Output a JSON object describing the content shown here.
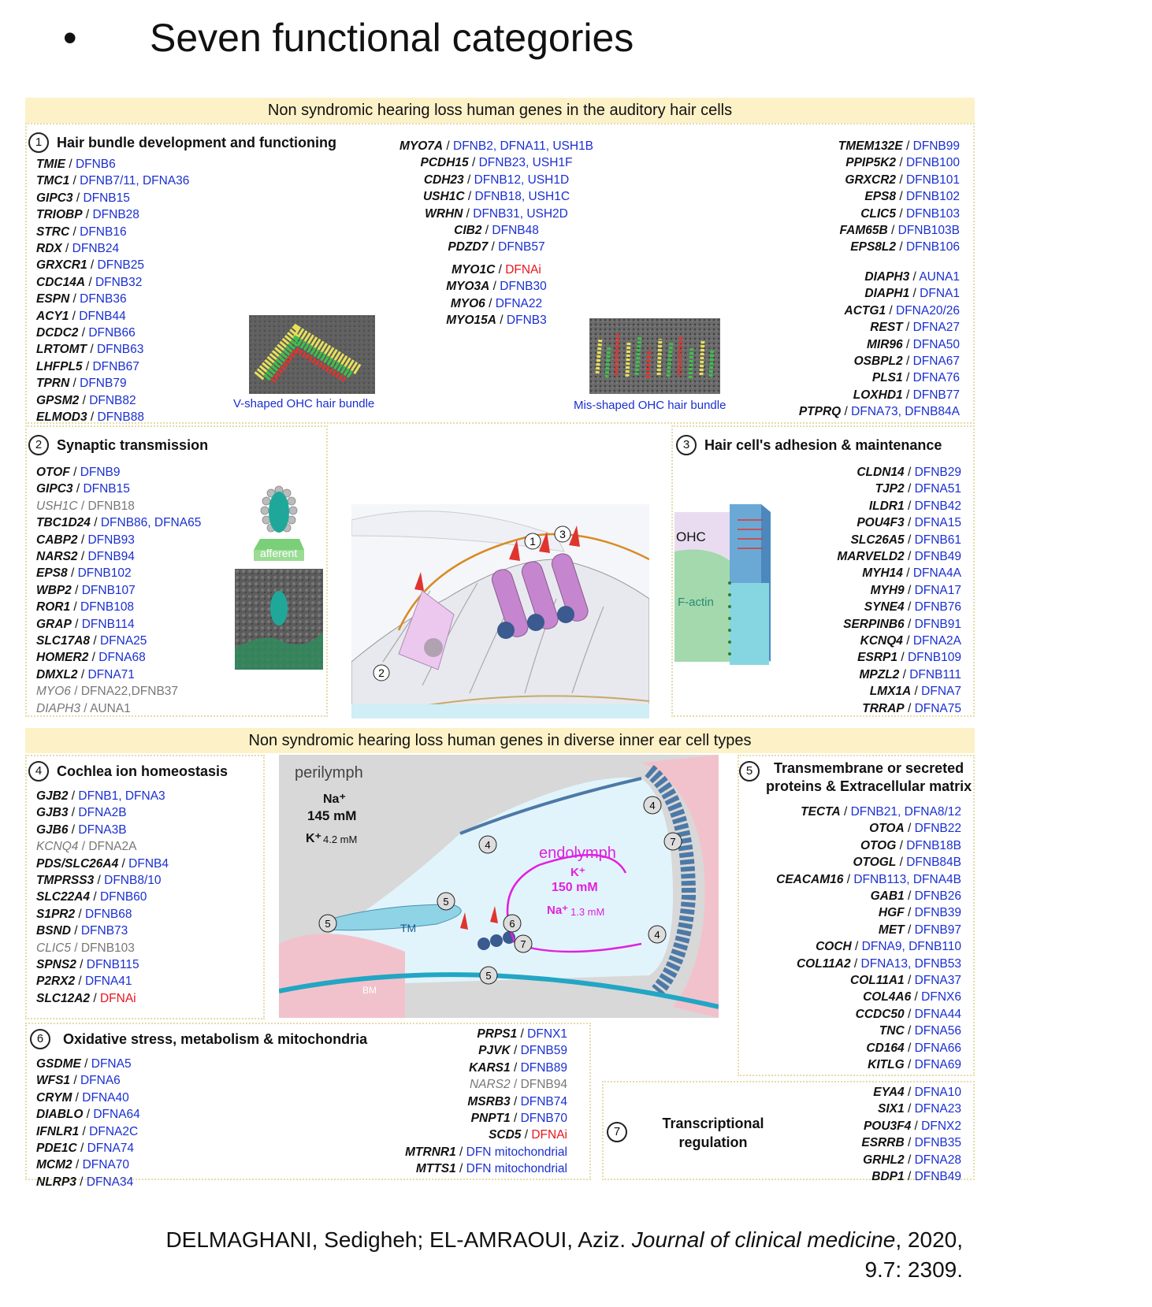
{
  "slide": {
    "bullet": "•",
    "title": "Seven functional categories"
  },
  "banner_top": "Non syndromic hearing loss human genes in the auditory hair cells",
  "banner_mid": "Non syndromic hearing loss human genes in diverse inner ear cell types",
  "sections": {
    "s1": {
      "num": "1",
      "title": "Hair bundle development and functioning",
      "col1": [
        {
          "g": "TMIE",
          "d": "DFNB6"
        },
        {
          "g": "TMC1",
          "d": "DFNB7/11, DFNA36"
        },
        {
          "g": "GIPC3",
          "d": "DFNB15"
        },
        {
          "g": "TRIOBP",
          "d": "DFNB28"
        },
        {
          "g": "STRC",
          "d": "DFNB16"
        },
        {
          "g": "RDX",
          "d": "DFNB24"
        },
        {
          "g": "GRXCR1",
          "d": "DFNB25"
        },
        {
          "g": "CDC14A",
          "d": "DFNB32"
        },
        {
          "g": "ESPN",
          "d": "DFNB36"
        },
        {
          "g": "ACY1",
          "d": "DFNB44"
        },
        {
          "g": "DCDC2",
          "d": "DFNB66"
        },
        {
          "g": "LRTOMT",
          "d": "DFNB63"
        },
        {
          "g": "LHFPL5",
          "d": "DFNB67"
        },
        {
          "g": "TPRN",
          "d": "DFNB79"
        },
        {
          "g": "GPSM2",
          "d": "DFNB82"
        },
        {
          "g": "ELMOD3",
          "d": "DFNB88"
        }
      ],
      "col2a": [
        {
          "g": "MYO7A",
          "d": "DFNB2, DFNA11, USH1B"
        },
        {
          "g": "PCDH15",
          "d": "DFNB23, USH1F"
        },
        {
          "g": "CDH23",
          "d": "DFNB12, USH1D"
        },
        {
          "g": "USH1C",
          "d": "DFNB18, USH1C"
        },
        {
          "g": "WRHN",
          "d": "DFNB31, USH2D"
        },
        {
          "g": "CIB2",
          "d": "DFNB48"
        },
        {
          "g": "PDZD7",
          "d": "DFNB57"
        }
      ],
      "col2b": [
        {
          "g": "MYO1C",
          "d": "DFNAi",
          "red": true
        },
        {
          "g": "MYO3A",
          "d": "DFNB30"
        },
        {
          "g": "MYO6",
          "d": "DFNA22"
        },
        {
          "g": "MYO15A",
          "d": "DFNB3"
        }
      ],
      "col3a": [
        {
          "g": "TMEM132E",
          "d": "DFNB99"
        },
        {
          "g": "PPIP5K2",
          "d": "DFNB100"
        },
        {
          "g": "GRXCR2",
          "d": "DFNB101"
        },
        {
          "g": "EPS8",
          "d": "DFNB102"
        },
        {
          "g": "CLIC5",
          "d": "DFNB103"
        },
        {
          "g": "FAM65B",
          "d": "DFNB103B"
        },
        {
          "g": "EPS8L2",
          "d": "DFNB106"
        }
      ],
      "col3b": [
        {
          "g": "DIAPH3",
          "d": "AUNA1"
        },
        {
          "g": "DIAPH1",
          "d": "DFNA1"
        },
        {
          "g": "ACTG1",
          "d": "DFNA20/26"
        },
        {
          "g": "REST",
          "d": "DFNA27"
        },
        {
          "g": "MIR96",
          "d": "DFNA50"
        },
        {
          "g": "OSBPL2",
          "d": "DFNA67"
        },
        {
          "g": "PLS1",
          "d": "DFNA76"
        },
        {
          "g": "LOXHD1",
          "d": "DFNB77"
        },
        {
          "g": "PTPRQ",
          "d": "DFNA73, DFNB84A"
        }
      ],
      "caption_left": "V-shaped OHC hair bundle",
      "caption_right": "Mis-shaped OHC hair bundle"
    },
    "s2": {
      "num": "2",
      "title": "Synaptic transmission",
      "genes": [
        {
          "g": "OTOF",
          "d": "DFNB9"
        },
        {
          "g": "GIPC3",
          "d": "DFNB15"
        },
        {
          "g": "USH1C",
          "d": "DFNB18",
          "gray": true
        },
        {
          "g": "TBC1D24",
          "d": "DFNB86, DFNA65"
        },
        {
          "g": "CABP2",
          "d": "DFNB93"
        },
        {
          "g": "NARS2",
          "d": "DFNB94"
        },
        {
          "g": "EPS8",
          "d": "DFNB102"
        },
        {
          "g": "WBP2",
          "d": "DFNB107"
        },
        {
          "g": "ROR1",
          "d": "DFNB108"
        },
        {
          "g": "GRAP",
          "d": "DFNB114"
        },
        {
          "g": "SLC17A8",
          "d": "DFNA25"
        },
        {
          "g": "HOMER2",
          "d": "DFNA68"
        },
        {
          "g": "DMXL2",
          "d": "DFNA71"
        },
        {
          "g": "MYO6",
          "d": "DFNA22,DFNB37",
          "gray": true
        },
        {
          "g": "DIAPH3",
          "d": "AUNA1",
          "gray": true
        }
      ],
      "afferent_label": "afferent"
    },
    "s3": {
      "num": "3",
      "title": "Hair cell's adhesion & maintenance",
      "genes": [
        {
          "g": "CLDN14",
          "d": "DFNB29"
        },
        {
          "g": "TJP2",
          "d": "DFNA51"
        },
        {
          "g": "ILDR1",
          "d": "DFNB42"
        },
        {
          "g": "POU4F3",
          "d": "DFNA15"
        },
        {
          "g": "SLC26A5",
          "d": "DFNB61"
        },
        {
          "g": "MARVELD2",
          "d": "DFNB49"
        },
        {
          "g": "MYH14",
          "d": "DFNA4A"
        },
        {
          "g": "MYH9",
          "d": "DFNA17"
        },
        {
          "g": "SYNE4",
          "d": "DFNB76"
        },
        {
          "g": "SERPINB6",
          "d": "DFNB91"
        },
        {
          "g": "KCNQ4",
          "d": "DFNA2A"
        },
        {
          "g": "ESRP1",
          "d": "DFNB109"
        },
        {
          "g": "MPZL2",
          "d": "DFNB111"
        },
        {
          "g": "LMX1A",
          "d": "DFNA7"
        },
        {
          "g": "TRRAP",
          "d": "DFNA75"
        }
      ],
      "ohc_label": "OHC",
      "factin_label": "F-actin"
    },
    "s4": {
      "num": "4",
      "title": "Cochlea ion homeostasis",
      "genes": [
        {
          "g": "GJB2",
          "d": "DFNB1, DFNA3"
        },
        {
          "g": "GJB3",
          "d": "DFNA2B"
        },
        {
          "g": "GJB6",
          "d": "DFNA3B"
        },
        {
          "g": "KCNQ4",
          "d": "DFNA2A",
          "gray": true
        },
        {
          "g": "PDS/SLC26A4",
          "d": "DFNB4"
        },
        {
          "g": "TMPRSS3",
          "d": "DFNB8/10"
        },
        {
          "g": "SLC22A4",
          "d": "DFNB60"
        },
        {
          "g": "S1PR2",
          "d": "DFNB68"
        },
        {
          "g": "BSND",
          "d": "DFNB73"
        },
        {
          "g": "CLIC5",
          "d": "DFNB103",
          "gray": true
        },
        {
          "g": "SPNS2",
          "d": "DFNB115"
        },
        {
          "g": "P2RX2",
          "d": "DFNA41"
        },
        {
          "g": "SLC12A2",
          "d": "DFNAi",
          "red": true
        }
      ]
    },
    "s5": {
      "num": "5",
      "title_line1": "Transmembrane or secreted",
      "title_line2": "proteins & Extracellular matrix",
      "genes": [
        {
          "g": "TECTA",
          "d": "DFNB21, DFNA8/12"
        },
        {
          "g": "OTOA",
          "d": "DFNB22"
        },
        {
          "g": "OTOG",
          "d": "DFNB18B"
        },
        {
          "g": "OTOGL",
          "d": "DFNB84B"
        },
        {
          "g": "CEACAM16",
          "d": "DFNB113, DFNA4B"
        },
        {
          "g": "GAB1",
          "d": "DFNB26"
        },
        {
          "g": "HGF",
          "d": "DFNB39"
        },
        {
          "g": "MET",
          "d": "DFNB97"
        },
        {
          "g": "COCH",
          "d": "DFNA9, DFNB110"
        },
        {
          "g": "COL11A2",
          "d": "DFNA13, DFNB53"
        },
        {
          "g": "COL11A1",
          "d": "DFNA37"
        },
        {
          "g": "COL4A6",
          "d": "DFNX6"
        },
        {
          "g": "CCDC50",
          "d": "DFNA44"
        },
        {
          "g": "TNC",
          "d": "DFNA56"
        },
        {
          "g": "CD164",
          "d": "DFNA66"
        },
        {
          "g": "KITLG",
          "d": "DFNA69"
        }
      ]
    },
    "s6": {
      "num": "6",
      "title": "Oxidative stress, metabolism & mitochondria",
      "col1": [
        {
          "g": "GSDME",
          "d": "DFNA5"
        },
        {
          "g": "WFS1",
          "d": "DFNA6"
        },
        {
          "g": "CRYM",
          "d": "DFNA40"
        },
        {
          "g": "DIABLO",
          "d": "DFNA64"
        },
        {
          "g": "IFNLR1",
          "d": "DFNA2C"
        },
        {
          "g": "PDE1C",
          "d": "DFNA74"
        },
        {
          "g": "MCM2",
          "d": "DFNA70"
        },
        {
          "g": "NLRP3",
          "d": "DFNA34"
        }
      ],
      "col2": [
        {
          "g": "PRPS1",
          "d": "DFNX1"
        },
        {
          "g": "PJVK",
          "d": "DFNB59"
        },
        {
          "g": "KARS1",
          "d": "DFNB89"
        },
        {
          "g": "NARS2",
          "d": "DFNB94",
          "gray": true
        },
        {
          "g": "MSRB3",
          "d": "DFNB74"
        },
        {
          "g": "PNPT1",
          "d": "DFNB70"
        },
        {
          "g": "SCD5",
          "d": "DFNAi",
          "red": true
        },
        {
          "g": "MTRNR1",
          "d": "DFN mitochondrial"
        },
        {
          "g": "MTTS1",
          "d": "DFN mitochondrial"
        }
      ]
    },
    "s7": {
      "num": "7",
      "title_line1": "Transcriptional",
      "title_line2": "regulation",
      "genes": [
        {
          "g": "EYA4",
          "d": "DFNA10"
        },
        {
          "g": "SIX1",
          "d": "DFNA23"
        },
        {
          "g": "POU3F4",
          "d": "DFNX2"
        },
        {
          "g": "ESRRB",
          "d": "DFNB35"
        },
        {
          "g": "GRHL2",
          "d": "DFNA28"
        },
        {
          "g": "BDP1",
          "d": "DFNB49"
        }
      ]
    }
  },
  "cochlea": {
    "perilymph": "perilymph",
    "peri_na": "Na⁺",
    "peri_na_conc": "145 mM",
    "peri_k": "K⁺",
    "peri_k_conc": "4.2 mM",
    "endolymph": "endolymph",
    "endo_k": "K⁺",
    "endo_k_conc": "150 mM",
    "endo_na": "Na⁺",
    "endo_na_conc": "1.3 mM",
    "tm": "TM",
    "bm": "BM"
  },
  "citation": {
    "authors": "DELMAGHANI, Sedigheh; EL-AMRAOUI, Aziz.",
    "journal": "Journal of clinical medicine",
    "line1_tail": ", 2020,",
    "line2": "9.7: 2309."
  },
  "colors": {
    "gene_link": "#1a2fd0",
    "dfnai": "#e8141e",
    "banner": "#fdf1c8",
    "endolymph": "#e020e0"
  }
}
